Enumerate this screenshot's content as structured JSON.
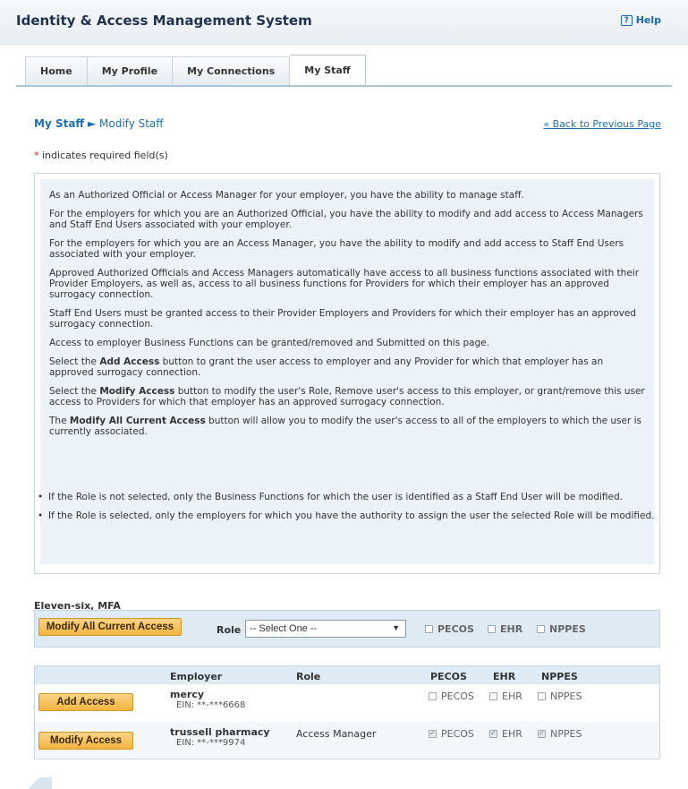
{
  "header": {
    "title": "Identity & Access Management System",
    "help_icon_text": "?",
    "help_label": "Help"
  },
  "tabs": [
    {
      "label": "Home"
    },
    {
      "label": "My Profile"
    },
    {
      "label": "My Connections"
    },
    {
      "label": "My Staff",
      "active": true
    }
  ],
  "breadcrumb": {
    "parent": "My Staff",
    "separator": "►",
    "current": "Modify Staff"
  },
  "back_link": "« Back to Previous Page",
  "required_note": {
    "star": "*",
    "text": " indicates required field(s)"
  },
  "info": {
    "p1": "As an Authorized Official or Access Manager for your employer, you have the ability to manage staff.",
    "p2": "For the employers for which you are an Authorized Official, you have the ability to modify and add access to Access Managers and Staff End Users associated with your employer.",
    "p3": "For the employers for which you are an Access Manager, you have the ability to modify and add access to Staff End Users associated with your employer.",
    "p4": "Approved Authorized Officials and Access Managers automatically have access to all business functions associated with their Provider Employers, as well as, access to all business functions for Providers for which their employer has an approved surrogacy connection.",
    "p5": "Staff End Users must be granted access to their Provider Employers and Providers for which their employer has an approved surrogacy connection.",
    "p6": "Access to employer Business Functions can be granted/removed and Submitted on this page.",
    "p7_pre": "Select the ",
    "p7_bold": "Add Access",
    "p7_post": " button to grant the user access to employer and any Provider for which that employer has an approved surrogacy connection.",
    "p8_pre": "Select the ",
    "p8_bold": "Modify Access",
    "p8_post": " button to modify the user's Role, Remove user's access to this employer, or grant/remove this user access to Providers for which that employer has an approved surrogacy connection.",
    "p9_pre": "The ",
    "p9_bold": "Modify All Current Access",
    "p9_post": " button will allow you to modify the user's access to all of the employers to which the user is currently associated.",
    "bullet1": "If the Role is not selected, only the Business Functions for which the user is identified as a Staff End User will be modified.",
    "bullet2": "If the Role is selected, only the employers for which you have the authority to assign the user the selected Role will be modified."
  },
  "staff_name": "Eleven-six, MFA",
  "modify_panel": {
    "button": "Modify All Current Access",
    "role_label": "Role",
    "role_select": "-- Select One --",
    "pecos": "PECOS",
    "ehr": "EHR",
    "nppes": "NPPES"
  },
  "table": {
    "headers": {
      "employer": "Employer",
      "role": "Role",
      "pecos": "PECOS",
      "ehr": "EHR",
      "nppes": "NPPES"
    },
    "rows": [
      {
        "button": "Add Access",
        "employer": "mercy",
        "ein": "EIN: **-***6668",
        "role": "",
        "pecos": "PECOS",
        "ehr": "EHR",
        "nppes": "NPPES",
        "checked": false
      },
      {
        "button": "Modify Access",
        "employer": "trussell pharmacy",
        "ein": "EIN: **-***9974",
        "role": "Access Manager",
        "pecos": "PECOS",
        "ehr": "EHR",
        "nppes": "NPPES",
        "checked": true
      }
    ]
  }
}
